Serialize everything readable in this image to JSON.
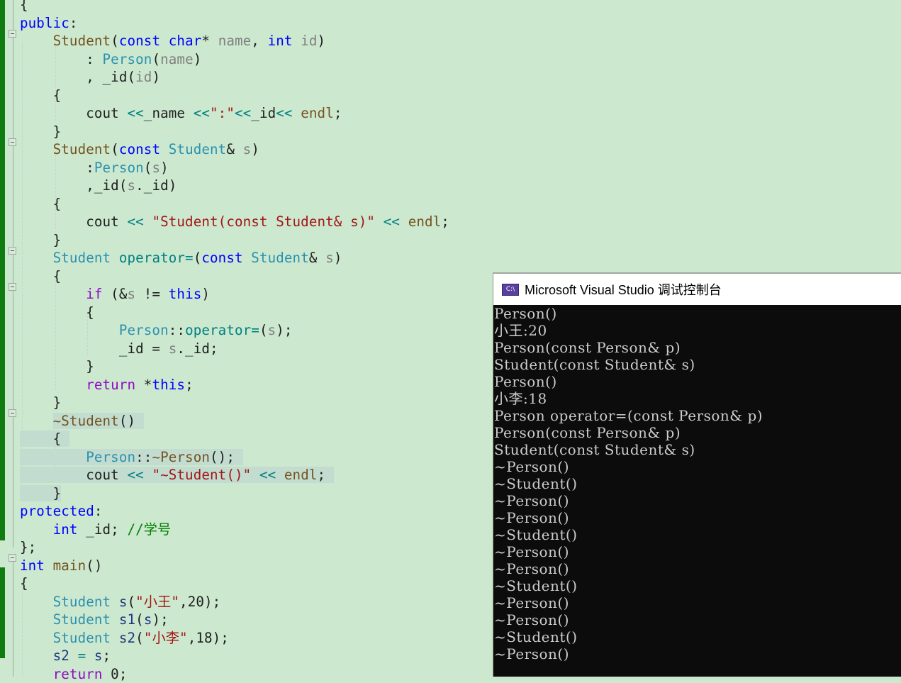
{
  "editor": {
    "lines": [
      {
        "tokens": [
          {
            "c": "tx",
            "t": "{"
          }
        ]
      },
      {
        "tokens": [
          {
            "c": "kw",
            "t": "public"
          },
          {
            "c": "tx",
            "t": ":"
          }
        ]
      },
      {
        "tokens": [
          {
            "c": "tx",
            "t": "    "
          },
          {
            "c": "fn",
            "t": "Student"
          },
          {
            "c": "tx",
            "t": "("
          },
          {
            "c": "kw",
            "t": "const"
          },
          {
            "c": "tx",
            "t": " "
          },
          {
            "c": "kw",
            "t": "char"
          },
          {
            "c": "tx",
            "t": "* "
          },
          {
            "c": "pa",
            "t": "name"
          },
          {
            "c": "tx",
            "t": ", "
          },
          {
            "c": "kw",
            "t": "int"
          },
          {
            "c": "tx",
            "t": " "
          },
          {
            "c": "pa",
            "t": "id"
          },
          {
            "c": "tx",
            "t": ")"
          }
        ]
      },
      {
        "tokens": [
          {
            "c": "tx",
            "t": "        : "
          },
          {
            "c": "ty",
            "t": "Person"
          },
          {
            "c": "tx",
            "t": "("
          },
          {
            "c": "pa",
            "t": "name"
          },
          {
            "c": "tx",
            "t": ")"
          }
        ]
      },
      {
        "tokens": [
          {
            "c": "tx",
            "t": "        , _id("
          },
          {
            "c": "pa",
            "t": "id"
          },
          {
            "c": "tx",
            "t": ")"
          }
        ]
      },
      {
        "tokens": [
          {
            "c": "tx",
            "t": "    {"
          }
        ]
      },
      {
        "tokens": [
          {
            "c": "tx",
            "t": "        cout "
          },
          {
            "c": "op",
            "t": "<<"
          },
          {
            "c": "tx",
            "t": "_name "
          },
          {
            "c": "op",
            "t": "<<"
          },
          {
            "c": "st",
            "t": "\":\""
          },
          {
            "c": "op",
            "t": "<<"
          },
          {
            "c": "tx",
            "t": "_id"
          },
          {
            "c": "op",
            "t": "<<"
          },
          {
            "c": "tx",
            "t": " "
          },
          {
            "c": "fn",
            "t": "endl"
          },
          {
            "c": "tx",
            "t": ";"
          }
        ]
      },
      {
        "tokens": [
          {
            "c": "tx",
            "t": "    }"
          }
        ]
      },
      {
        "tokens": [
          {
            "c": "tx",
            "t": "    "
          },
          {
            "c": "fn",
            "t": "Student"
          },
          {
            "c": "tx",
            "t": "("
          },
          {
            "c": "kw",
            "t": "const"
          },
          {
            "c": "tx",
            "t": " "
          },
          {
            "c": "ty",
            "t": "Student"
          },
          {
            "c": "tx",
            "t": "& "
          },
          {
            "c": "pa",
            "t": "s"
          },
          {
            "c": "tx",
            "t": ")"
          }
        ]
      },
      {
        "tokens": [
          {
            "c": "tx",
            "t": "        :"
          },
          {
            "c": "ty",
            "t": "Person"
          },
          {
            "c": "tx",
            "t": "("
          },
          {
            "c": "pa",
            "t": "s"
          },
          {
            "c": "tx",
            "t": ")"
          }
        ]
      },
      {
        "tokens": [
          {
            "c": "tx",
            "t": "        ,_id("
          },
          {
            "c": "pa",
            "t": "s"
          },
          {
            "c": "tx",
            "t": "._id)"
          }
        ]
      },
      {
        "tokens": [
          {
            "c": "tx",
            "t": "    {"
          }
        ]
      },
      {
        "tokens": [
          {
            "c": "tx",
            "t": "        cout "
          },
          {
            "c": "op",
            "t": "<<"
          },
          {
            "c": "tx",
            "t": " "
          },
          {
            "c": "st",
            "t": "\"Student(const Student& s)\""
          },
          {
            "c": "tx",
            "t": " "
          },
          {
            "c": "op",
            "t": "<<"
          },
          {
            "c": "tx",
            "t": " "
          },
          {
            "c": "fn",
            "t": "endl"
          },
          {
            "c": "tx",
            "t": ";"
          }
        ]
      },
      {
        "tokens": [
          {
            "c": "tx",
            "t": "    }"
          }
        ]
      },
      {
        "tokens": [
          {
            "c": "tx",
            "t": "    "
          },
          {
            "c": "ty",
            "t": "Student"
          },
          {
            "c": "tx",
            "t": " "
          },
          {
            "c": "op",
            "t": "operator="
          },
          {
            "c": "tx",
            "t": "("
          },
          {
            "c": "kw",
            "t": "const"
          },
          {
            "c": "tx",
            "t": " "
          },
          {
            "c": "ty",
            "t": "Student"
          },
          {
            "c": "tx",
            "t": "& "
          },
          {
            "c": "pa",
            "t": "s"
          },
          {
            "c": "tx",
            "t": ")"
          }
        ]
      },
      {
        "tokens": [
          {
            "c": "tx",
            "t": "    {"
          }
        ]
      },
      {
        "tokens": [
          {
            "c": "tx",
            "t": "        "
          },
          {
            "c": "kw2",
            "t": "if"
          },
          {
            "c": "tx",
            "t": " (&"
          },
          {
            "c": "pa",
            "t": "s"
          },
          {
            "c": "tx",
            "t": " != "
          },
          {
            "c": "kw",
            "t": "this"
          },
          {
            "c": "tx",
            "t": ")"
          }
        ]
      },
      {
        "tokens": [
          {
            "c": "tx",
            "t": "        {"
          }
        ]
      },
      {
        "tokens": [
          {
            "c": "tx",
            "t": "            "
          },
          {
            "c": "ty",
            "t": "Person"
          },
          {
            "c": "tx",
            "t": "::"
          },
          {
            "c": "op",
            "t": "operator="
          },
          {
            "c": "tx",
            "t": "("
          },
          {
            "c": "pa",
            "t": "s"
          },
          {
            "c": "tx",
            "t": ");"
          }
        ]
      },
      {
        "tokens": [
          {
            "c": "tx",
            "t": "            _id = "
          },
          {
            "c": "pa",
            "t": "s"
          },
          {
            "c": "tx",
            "t": "._id;"
          }
        ]
      },
      {
        "tokens": [
          {
            "c": "tx",
            "t": "        }"
          }
        ]
      },
      {
        "tokens": [
          {
            "c": "tx",
            "t": "        "
          },
          {
            "c": "kw2",
            "t": "return"
          },
          {
            "c": "tx",
            "t": " *"
          },
          {
            "c": "kw",
            "t": "this"
          },
          {
            "c": "tx",
            "t": ";"
          }
        ]
      },
      {
        "tokens": [
          {
            "c": "tx",
            "t": "    }"
          }
        ]
      },
      {
        "tokens": [
          {
            "c": "tx",
            "t": "    "
          },
          {
            "c": "fn",
            "t": "~Student"
          },
          {
            "c": "tx",
            "t": "() "
          }
        ],
        "hl_from": 4
      },
      {
        "tokens": [
          {
            "c": "tx",
            "t": "    { "
          }
        ],
        "hl_from": 0
      },
      {
        "tokens": [
          {
            "c": "tx",
            "t": "        "
          },
          {
            "c": "ty",
            "t": "Person"
          },
          {
            "c": "tx",
            "t": "::"
          },
          {
            "c": "fn",
            "t": "~Person"
          },
          {
            "c": "tx",
            "t": "(); "
          }
        ],
        "hl_from": 0
      },
      {
        "tokens": [
          {
            "c": "tx",
            "t": "        cout "
          },
          {
            "c": "op",
            "t": "<<"
          },
          {
            "c": "tx",
            "t": " "
          },
          {
            "c": "st",
            "t": "\"~Student()\""
          },
          {
            "c": "tx",
            "t": " "
          },
          {
            "c": "op",
            "t": "<<"
          },
          {
            "c": "tx",
            "t": " "
          },
          {
            "c": "fn",
            "t": "endl"
          },
          {
            "c": "tx",
            "t": "; "
          }
        ],
        "hl_from": 0
      },
      {
        "tokens": [
          {
            "c": "tx",
            "t": "    }"
          }
        ],
        "hl_from": 0
      },
      {
        "tokens": [
          {
            "c": "kw",
            "t": "protected"
          },
          {
            "c": "tx",
            "t": ":"
          }
        ]
      },
      {
        "tokens": [
          {
            "c": "tx",
            "t": "    "
          },
          {
            "c": "kw",
            "t": "int"
          },
          {
            "c": "tx",
            "t": " _id; "
          },
          {
            "c": "cm",
            "t": "//学号"
          }
        ]
      },
      {
        "tokens": [
          {
            "c": "tx",
            "t": "};"
          }
        ]
      },
      {
        "tokens": [
          {
            "c": "kw",
            "t": "int"
          },
          {
            "c": "tx",
            "t": " "
          },
          {
            "c": "fn",
            "t": "main"
          },
          {
            "c": "tx",
            "t": "()"
          }
        ]
      },
      {
        "tokens": [
          {
            "c": "tx",
            "t": "{"
          }
        ]
      },
      {
        "tokens": [
          {
            "c": "tx",
            "t": "    "
          },
          {
            "c": "ty",
            "t": "Student"
          },
          {
            "c": "tx",
            "t": " "
          },
          {
            "c": "va",
            "t": "s"
          },
          {
            "c": "tx",
            "t": "("
          },
          {
            "c": "st",
            "t": "\"小王\""
          },
          {
            "c": "tx",
            "t": ",20);"
          }
        ]
      },
      {
        "tokens": [
          {
            "c": "tx",
            "t": "    "
          },
          {
            "c": "ty",
            "t": "Student"
          },
          {
            "c": "tx",
            "t": " "
          },
          {
            "c": "va",
            "t": "s1"
          },
          {
            "c": "tx",
            "t": "("
          },
          {
            "c": "va",
            "t": "s"
          },
          {
            "c": "tx",
            "t": ");"
          }
        ]
      },
      {
        "tokens": [
          {
            "c": "tx",
            "t": "    "
          },
          {
            "c": "ty",
            "t": "Student"
          },
          {
            "c": "tx",
            "t": " "
          },
          {
            "c": "va",
            "t": "s2"
          },
          {
            "c": "tx",
            "t": "("
          },
          {
            "c": "st",
            "t": "\"小李\""
          },
          {
            "c": "tx",
            "t": ",18);"
          }
        ]
      },
      {
        "tokens": [
          {
            "c": "tx",
            "t": "    "
          },
          {
            "c": "va",
            "t": "s2"
          },
          {
            "c": "tx",
            "t": " "
          },
          {
            "c": "op",
            "t": "="
          },
          {
            "c": "tx",
            "t": " "
          },
          {
            "c": "va",
            "t": "s"
          },
          {
            "c": "tx",
            "t": ";"
          }
        ]
      },
      {
        "tokens": [
          {
            "c": "tx",
            "t": "    "
          },
          {
            "c": "kw2",
            "t": "return"
          },
          {
            "c": "tx",
            "t": " 0;"
          }
        ]
      }
    ]
  },
  "console": {
    "title": "Microsoft Visual Studio 调试控制台",
    "icon_text": "C:\\",
    "output": [
      "Person()",
      "小王:20",
      "Person(const Person& p)",
      "Student(const Student& s)",
      "Person()",
      "小李:18",
      "Person operator=(const Person& p)",
      "Person(const Person& p)",
      "Student(const Student& s)",
      "~Person()",
      "~Student()",
      "~Person()",
      "~Person()",
      "~Student()",
      "~Person()",
      "~Person()",
      "~Student()",
      "~Person()",
      "~Person()",
      "~Student()",
      "~Person()"
    ]
  }
}
